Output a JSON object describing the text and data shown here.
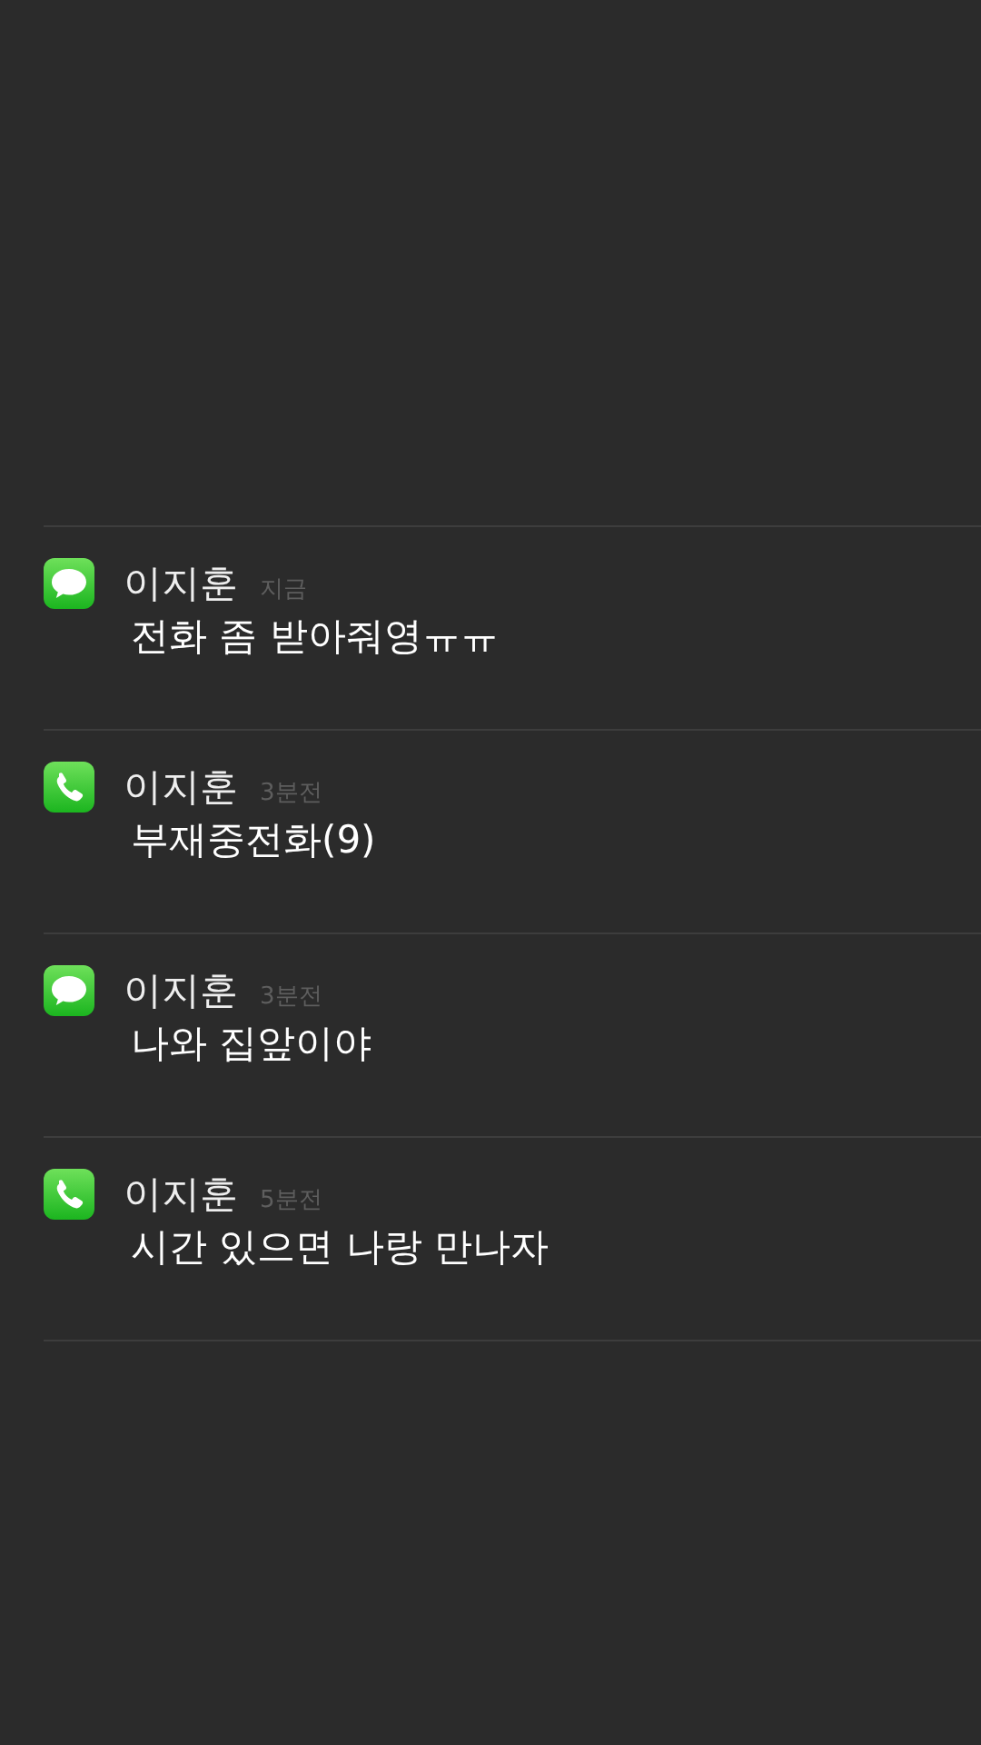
{
  "notifications": [
    {
      "kind": "message",
      "sender": "이지훈",
      "time": "지금",
      "text": "전화 좀 받아줘영ㅠㅠ"
    },
    {
      "kind": "call",
      "sender": "이지훈",
      "time": "3분전",
      "text": "부재중전화(9)"
    },
    {
      "kind": "message",
      "sender": "이지훈",
      "time": "3분전",
      "text": "나와 집앞이야"
    },
    {
      "kind": "call",
      "sender": "이지훈",
      "time": "5분전",
      "text": "시간 있으면 나랑 만나자"
    }
  ]
}
